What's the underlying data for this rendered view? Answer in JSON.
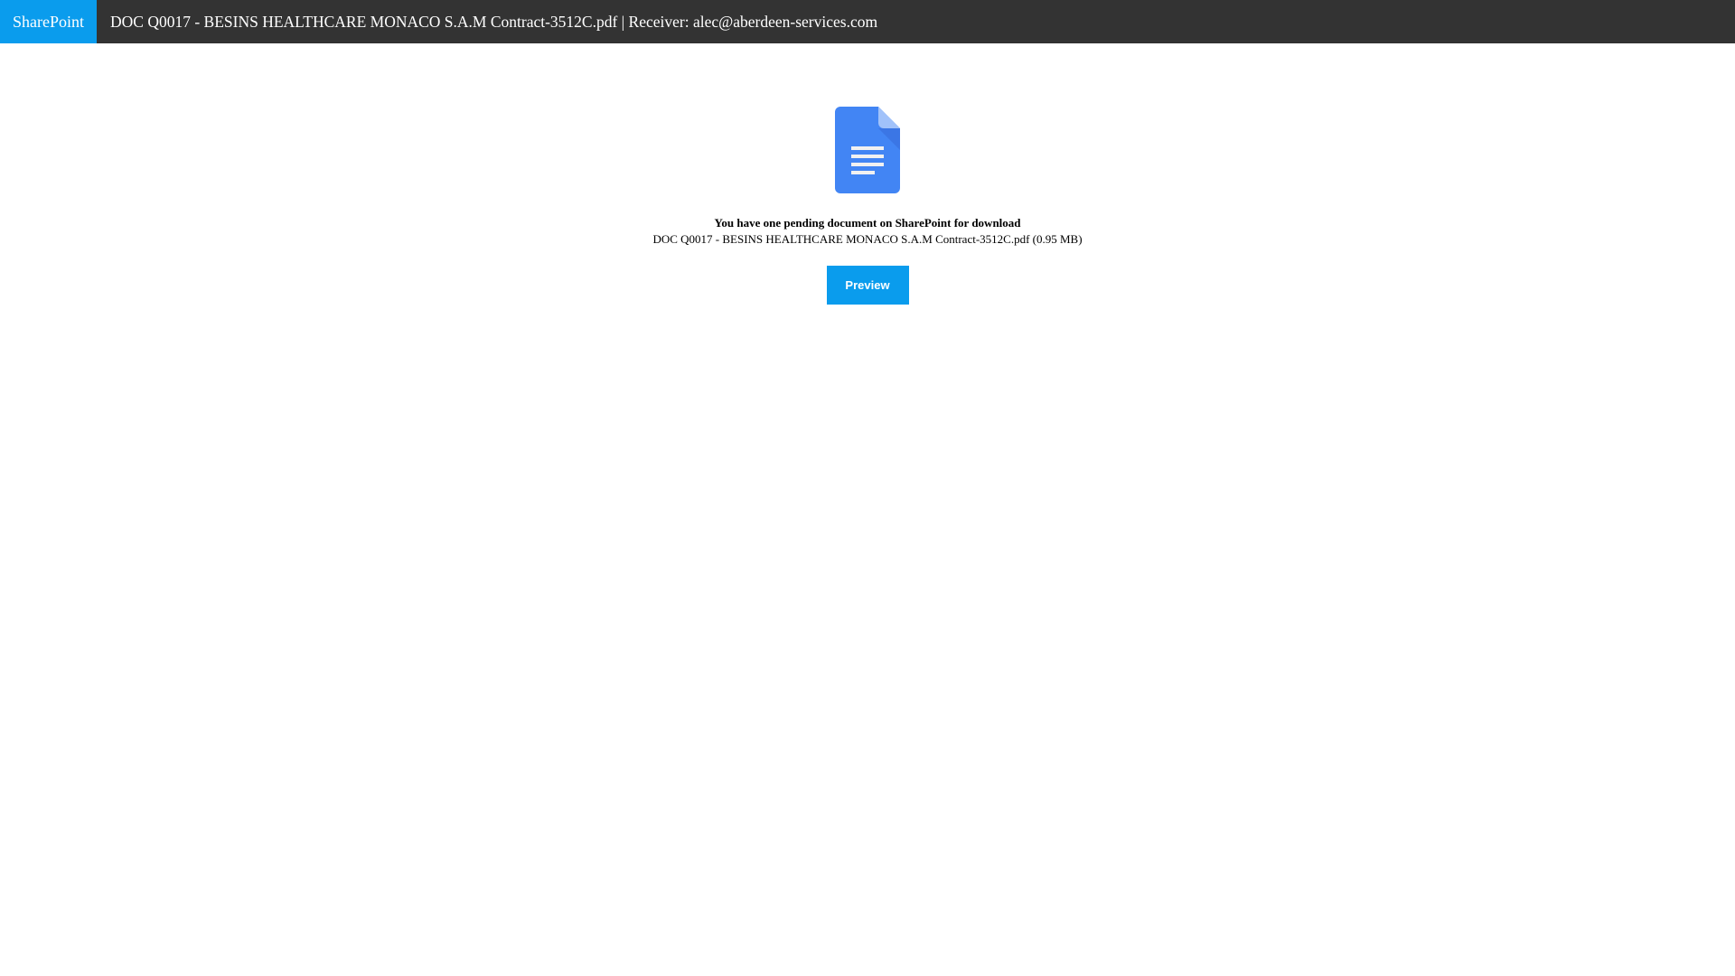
{
  "header": {
    "brand": "SharePoint",
    "title": "DOC Q0017 - BESINS HEALTHCARE MONACO S.A.M Contract-3512C.pdf | Receiver: alec@aberdeen-services.com"
  },
  "main": {
    "icon": "google-docs-document-icon",
    "message": "You have one pending document on SharePoint for download",
    "file_name": "DOC Q0017 - BESINS HEALTHCARE MONACO S.A.M Contract-3512C.pdf",
    "file_size": "(0.95 MB)",
    "file_line": "DOC Q0017 - BESINS HEALTHCARE MONACO S.A.M Contract-3512C.pdf (0.95 MB)",
    "button_label": "Preview"
  },
  "colors": {
    "topbar": "#333333",
    "accent": "#0a9ced",
    "doc_icon": "#4285f4",
    "doc_fold": "#a1c2fa"
  }
}
